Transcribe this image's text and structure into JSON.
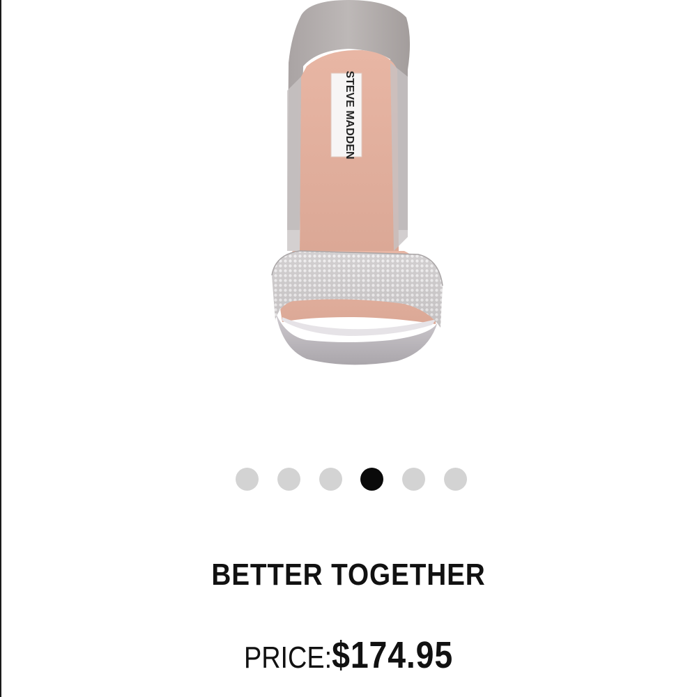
{
  "product_image": {
    "label_text": "STEVE MADDEN",
    "alt": "Steve Madden sandal"
  },
  "carousel": {
    "total": 6,
    "active_index": 3
  },
  "product": {
    "title": "BETTER TOGETHER",
    "price_label": "PRICE:",
    "price_value": "$174.95"
  }
}
